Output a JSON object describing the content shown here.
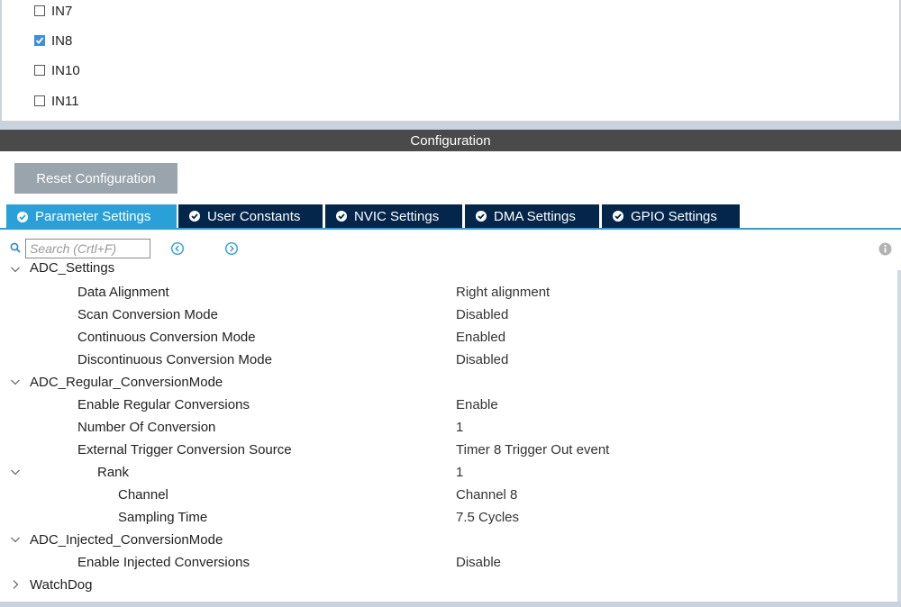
{
  "channels": [
    {
      "label": "IN7",
      "checked": false
    },
    {
      "label": "IN8",
      "checked": true
    },
    {
      "label": "IN10",
      "checked": false
    },
    {
      "label": "IN11",
      "checked": false
    }
  ],
  "config": {
    "header": "Configuration",
    "reset_label": "Reset Configuration"
  },
  "tabs": [
    {
      "label": "Parameter Settings",
      "active": true
    },
    {
      "label": "User Constants",
      "active": false
    },
    {
      "label": "NVIC Settings",
      "active": false
    },
    {
      "label": "DMA Settings",
      "active": false
    },
    {
      "label": "GPIO Settings",
      "active": false
    }
  ],
  "search": {
    "placeholder": "Search (Crtl+F)",
    "value": ""
  },
  "params": {
    "adc_settings": {
      "label": "ADC_Settings",
      "items": [
        {
          "label": "Data Alignment",
          "value": "Right alignment"
        },
        {
          "label": "Scan Conversion Mode",
          "value": "Disabled"
        },
        {
          "label": "Continuous Conversion Mode",
          "value": "Enabled"
        },
        {
          "label": "Discontinuous Conversion Mode",
          "value": "Disabled"
        }
      ]
    },
    "regular": {
      "label": "ADC_Regular_ConversionMode",
      "items": [
        {
          "label": "Enable Regular Conversions",
          "value": "Enable"
        },
        {
          "label": "Number Of Conversion",
          "value": "1"
        },
        {
          "label": "External Trigger Conversion Source",
          "value": "Timer 8 Trigger Out event"
        }
      ],
      "rank": {
        "label": "Rank",
        "value": "1",
        "items": [
          {
            "label": "Channel",
            "value": "Channel 8"
          },
          {
            "label": "Sampling Time",
            "value": "7.5 Cycles"
          }
        ]
      }
    },
    "injected": {
      "label": "ADC_Injected_ConversionMode",
      "items": [
        {
          "label": "Enable Injected Conversions",
          "value": "Disable"
        }
      ]
    },
    "watchdog": {
      "label": "WatchDog"
    }
  },
  "colors": {
    "accent": "#2aa0d8",
    "tab_dark": "#04264a",
    "header": "#4a4a4a",
    "button": "#9aa4ad"
  },
  "icons": {
    "search": "search-icon",
    "prev": "chevron-left-circle-icon",
    "next": "chevron-right-circle-icon",
    "info": "info-icon",
    "expanded": "chevron-down-icon",
    "collapsed": "chevron-right-icon",
    "tab_status": "check-circle-icon"
  }
}
